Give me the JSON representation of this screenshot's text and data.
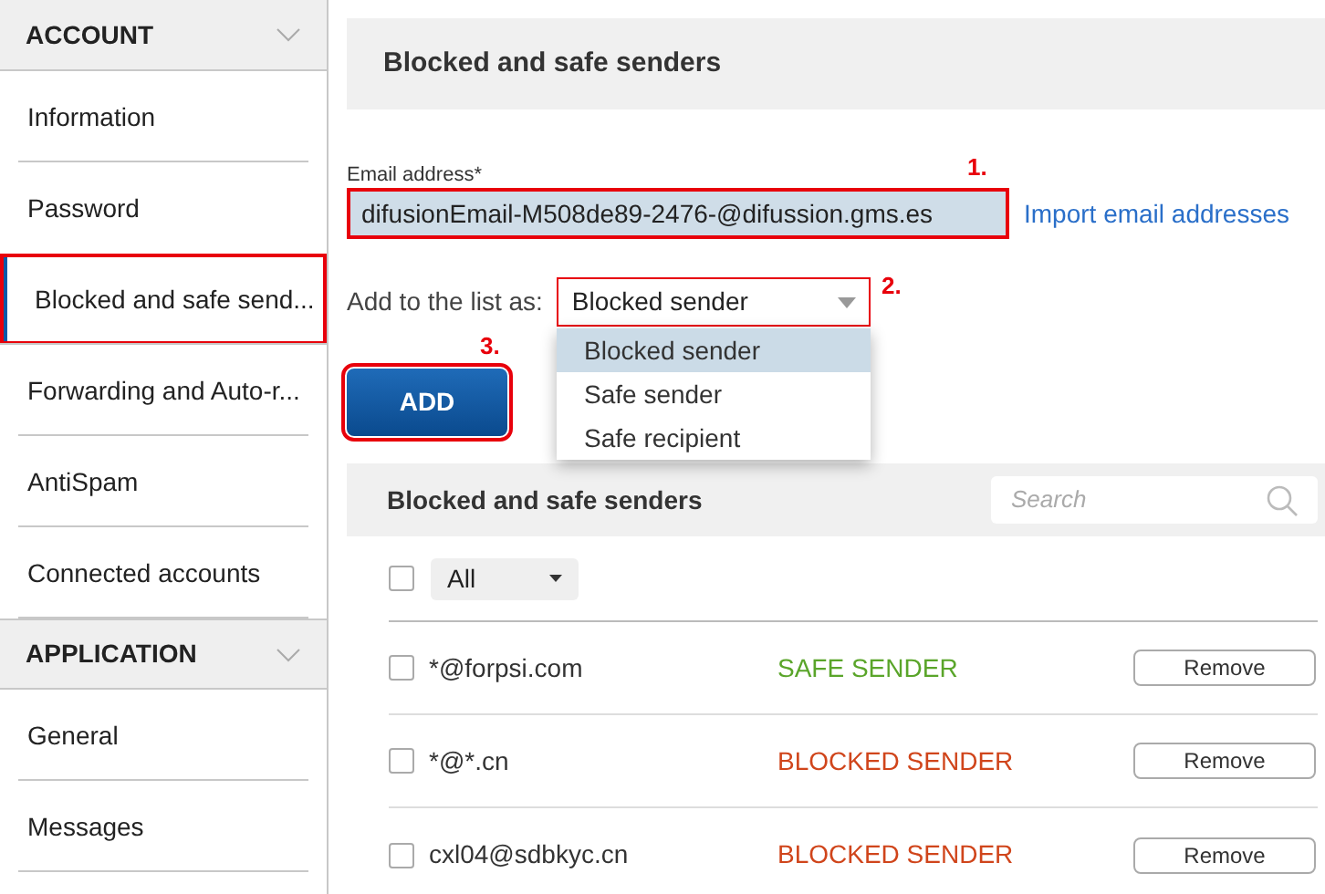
{
  "sidebar": [
    {
      "title": "ACCOUNT",
      "expanded": true,
      "items": [
        {
          "label": "Information",
          "selected": false,
          "highlighted": false
        },
        {
          "label": "Password",
          "selected": false,
          "highlighted": false
        },
        {
          "label": "Blocked and safe send...",
          "selected": true,
          "highlighted": true
        },
        {
          "label": "Forwarding and Auto-r...",
          "selected": false,
          "highlighted": false
        },
        {
          "label": "AntiSpam",
          "selected": false,
          "highlighted": false
        },
        {
          "label": "Connected accounts",
          "selected": false,
          "highlighted": false
        }
      ]
    },
    {
      "title": "APPLICATION",
      "expanded": true,
      "items": [
        {
          "label": "General",
          "selected": false,
          "highlighted": false
        },
        {
          "label": "Messages",
          "selected": false,
          "highlighted": false
        }
      ]
    }
  ],
  "page_title": "Blocked and safe senders",
  "email_field": {
    "label": "Email address*",
    "value": "difusionEmail-M508de89-2476-@difussion.gms.es",
    "highlighted": true,
    "step": "1."
  },
  "import_link": "Import email addresses",
  "list_type": {
    "label": "Add to the list as:",
    "value": "Blocked sender",
    "highlighted": true,
    "step": "2.",
    "expanded": true,
    "options": [
      {
        "label": "Blocked sender",
        "selected": true
      },
      {
        "label": "Safe sender",
        "selected": false
      },
      {
        "label": "Safe recipient",
        "selected": false
      }
    ]
  },
  "add_button": {
    "label": "ADD",
    "highlighted": true,
    "step": "3."
  },
  "list": {
    "title": "Blocked and safe senders",
    "search_placeholder": "Search",
    "filter": "All",
    "select_all": false,
    "rows": [
      {
        "address": "*@forpsi.com",
        "status": "SAFE SENDER",
        "kind": "safe",
        "checked": false,
        "action": "Remove"
      },
      {
        "address": "*@*.cn",
        "status": "BLOCKED SENDER",
        "kind": "blocked",
        "checked": false,
        "action": "Remove"
      },
      {
        "address": "cxl04@sdbkyc.cn",
        "status": "BLOCKED SENDER",
        "kind": "blocked",
        "checked": false,
        "action": "Remove"
      }
    ]
  }
}
